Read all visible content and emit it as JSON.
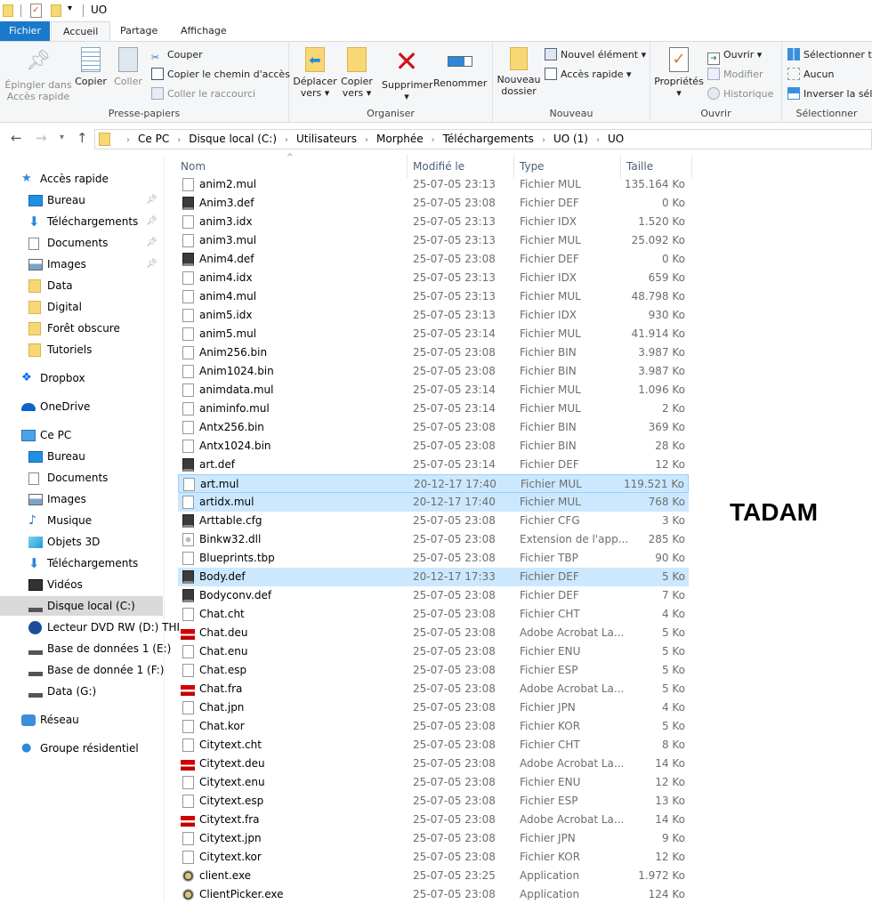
{
  "window": {
    "title": "UO"
  },
  "tabs": [
    {
      "label": "Fichier"
    },
    {
      "label": "Accueil"
    },
    {
      "label": "Partage"
    },
    {
      "label": "Affichage"
    }
  ],
  "ribbon": {
    "presse_papiers": {
      "label": "Presse-papiers",
      "pin": "Épingler dans Accès rapide",
      "pin_l1": "Épingler dans",
      "pin_l2": "Accès rapide",
      "copy": "Copier",
      "paste": "Coller",
      "cut": "Couper",
      "copy_path": "Copier le chemin d'accès",
      "paste_shortcut": "Coller le raccourci"
    },
    "organiser": {
      "label": "Organiser",
      "move_l1": "Déplacer",
      "move_l2": "vers",
      "copy_l1": "Copier",
      "copy_l2": "vers",
      "delete": "Supprimer",
      "rename": "Renommer"
    },
    "nouveau": {
      "label": "Nouveau",
      "new_folder_l1": "Nouveau",
      "new_folder_l2": "dossier",
      "new_item": "Nouvel élément",
      "easy_access": "Accès rapide"
    },
    "ouvrir": {
      "label": "Ouvrir",
      "properties": "Propriétés",
      "open": "Ouvrir",
      "edit": "Modifier",
      "history": "Historique"
    },
    "selectionner": {
      "label": "Sélectionner",
      "select_all": "Sélectionner tout",
      "none": "Aucun",
      "invert": "Inverser la sélection"
    }
  },
  "address": {
    "crumbs": [
      "Ce PC",
      "Disque local (C:)",
      "Utilisateurs",
      "Morphée",
      "Téléchargements",
      "UO (1)",
      "UO"
    ]
  },
  "sidebar": {
    "items": [
      {
        "label": "Accès rapide",
        "icon": "star-icon",
        "level": 0
      },
      {
        "label": "Bureau",
        "icon": "desktop-icon",
        "level": 1,
        "pinned": true
      },
      {
        "label": "Téléchargements",
        "icon": "download-icon",
        "level": 1,
        "pinned": true
      },
      {
        "label": "Documents",
        "icon": "documents-icon",
        "level": 1,
        "pinned": true
      },
      {
        "label": "Images",
        "icon": "images-icon",
        "level": 1,
        "pinned": true
      },
      {
        "label": "Data",
        "icon": "folder-icon",
        "level": 1
      },
      {
        "label": "Digital",
        "icon": "folder-icon",
        "level": 1
      },
      {
        "label": "Forêt obscure",
        "icon": "folder-icon",
        "level": 1
      },
      {
        "label": "Tutoriels",
        "icon": "folder-icon",
        "level": 1
      },
      {
        "label": "Dropbox",
        "icon": "dropbox-icon",
        "level": 0
      },
      {
        "label": "OneDrive",
        "icon": "onedrive-icon",
        "level": 0
      },
      {
        "label": "Ce PC",
        "icon": "computer-icon",
        "level": 0
      },
      {
        "label": "Bureau",
        "icon": "desktop-icon",
        "level": 1
      },
      {
        "label": "Documents",
        "icon": "documents-icon",
        "level": 1
      },
      {
        "label": "Images",
        "icon": "images-icon",
        "level": 1
      },
      {
        "label": "Musique",
        "icon": "music-icon",
        "level": 1
      },
      {
        "label": "Objets 3D",
        "icon": "objects3d-icon",
        "level": 1
      },
      {
        "label": "Téléchargements",
        "icon": "download-icon",
        "level": 1
      },
      {
        "label": "Vidéos",
        "icon": "videos-icon",
        "level": 1
      },
      {
        "label": "Disque local (C:)",
        "icon": "drive-icon",
        "level": 1,
        "selected": true
      },
      {
        "label": "Lecteur DVD RW (D:) THI",
        "icon": "dvd-icon",
        "level": 1
      },
      {
        "label": "Base de données 1 (E:)",
        "icon": "drive-icon",
        "level": 1
      },
      {
        "label": "Base de donnée 1 (F:)",
        "icon": "drive-icon",
        "level": 1
      },
      {
        "label": "Data (G:)",
        "icon": "drive-icon",
        "level": 1
      },
      {
        "label": "Réseau",
        "icon": "network-icon",
        "level": 0
      },
      {
        "label": "Groupe résidentiel",
        "icon": "homegroup-icon",
        "level": 0
      }
    ]
  },
  "columns": {
    "name": "Nom",
    "modified": "Modifié le",
    "type": "Type",
    "size": "Taille"
  },
  "files": [
    {
      "name": "anim2.mul",
      "date": "25-07-05 23:13",
      "type": "Fichier MUL",
      "size": "135.164 Ko",
      "icon": "file"
    },
    {
      "name": "Anim3.def",
      "date": "25-07-05 23:08",
      "type": "Fichier DEF",
      "size": "0 Ko",
      "icon": "sublime"
    },
    {
      "name": "anim3.idx",
      "date": "25-07-05 23:13",
      "type": "Fichier IDX",
      "size": "1.520 Ko",
      "icon": "file"
    },
    {
      "name": "anim3.mul",
      "date": "25-07-05 23:13",
      "type": "Fichier MUL",
      "size": "25.092 Ko",
      "icon": "file"
    },
    {
      "name": "Anim4.def",
      "date": "25-07-05 23:08",
      "type": "Fichier DEF",
      "size": "0 Ko",
      "icon": "sublime"
    },
    {
      "name": "anim4.idx",
      "date": "25-07-05 23:13",
      "type": "Fichier IDX",
      "size": "659 Ko",
      "icon": "file"
    },
    {
      "name": "anim4.mul",
      "date": "25-07-05 23:13",
      "type": "Fichier MUL",
      "size": "48.798 Ko",
      "icon": "file"
    },
    {
      "name": "anim5.idx",
      "date": "25-07-05 23:13",
      "type": "Fichier IDX",
      "size": "930 Ko",
      "icon": "file"
    },
    {
      "name": "anim5.mul",
      "date": "25-07-05 23:14",
      "type": "Fichier MUL",
      "size": "41.914 Ko",
      "icon": "file"
    },
    {
      "name": "Anim256.bin",
      "date": "25-07-05 23:08",
      "type": "Fichier BIN",
      "size": "3.987 Ko",
      "icon": "file"
    },
    {
      "name": "Anim1024.bin",
      "date": "25-07-05 23:08",
      "type": "Fichier BIN",
      "size": "3.987 Ko",
      "icon": "file"
    },
    {
      "name": "animdata.mul",
      "date": "25-07-05 23:14",
      "type": "Fichier MUL",
      "size": "1.096 Ko",
      "icon": "file"
    },
    {
      "name": "animinfo.mul",
      "date": "25-07-05 23:14",
      "type": "Fichier MUL",
      "size": "2 Ko",
      "icon": "file"
    },
    {
      "name": "Antx256.bin",
      "date": "25-07-05 23:08",
      "type": "Fichier BIN",
      "size": "369 Ko",
      "icon": "file"
    },
    {
      "name": "Antx1024.bin",
      "date": "25-07-05 23:08",
      "type": "Fichier BIN",
      "size": "28 Ko",
      "icon": "file"
    },
    {
      "name": "art.def",
      "date": "25-07-05 23:14",
      "type": "Fichier DEF",
      "size": "12 Ko",
      "icon": "sublime"
    },
    {
      "name": "art.mul",
      "date": "20-12-17 17:40",
      "type": "Fichier MUL",
      "size": "119.521 Ko",
      "icon": "file",
      "selected": true,
      "focused": true
    },
    {
      "name": "artidx.mul",
      "date": "20-12-17 17:40",
      "type": "Fichier MUL",
      "size": "768 Ko",
      "icon": "file",
      "selected": true
    },
    {
      "name": "Arttable.cfg",
      "date": "25-07-05 23:08",
      "type": "Fichier CFG",
      "size": "3 Ko",
      "icon": "sublime"
    },
    {
      "name": "Binkw32.dll",
      "date": "25-07-05 23:08",
      "type": "Extension de l'app...",
      "size": "285 Ko",
      "icon": "dll"
    },
    {
      "name": "Blueprints.tbp",
      "date": "25-07-05 23:08",
      "type": "Fichier TBP",
      "size": "90 Ko",
      "icon": "file"
    },
    {
      "name": "Body.def",
      "date": "20-12-17 17:33",
      "type": "Fichier DEF",
      "size": "5 Ko",
      "icon": "sublime",
      "selected": true
    },
    {
      "name": "Bodyconv.def",
      "date": "25-07-05 23:08",
      "type": "Fichier DEF",
      "size": "7 Ko",
      "icon": "sublime"
    },
    {
      "name": "Chat.cht",
      "date": "25-07-05 23:08",
      "type": "Fichier CHT",
      "size": "4 Ko",
      "icon": "file"
    },
    {
      "name": "Chat.deu",
      "date": "25-07-05 23:08",
      "type": "Adobe Acrobat La...",
      "size": "5 Ko",
      "icon": "acrobat"
    },
    {
      "name": "Chat.enu",
      "date": "25-07-05 23:08",
      "type": "Fichier ENU",
      "size": "5 Ko",
      "icon": "file"
    },
    {
      "name": "Chat.esp",
      "date": "25-07-05 23:08",
      "type": "Fichier ESP",
      "size": "5 Ko",
      "icon": "file"
    },
    {
      "name": "Chat.fra",
      "date": "25-07-05 23:08",
      "type": "Adobe Acrobat La...",
      "size": "5 Ko",
      "icon": "acrobat"
    },
    {
      "name": "Chat.jpn",
      "date": "25-07-05 23:08",
      "type": "Fichier JPN",
      "size": "4 Ko",
      "icon": "file"
    },
    {
      "name": "Chat.kor",
      "date": "25-07-05 23:08",
      "type": "Fichier KOR",
      "size": "5 Ko",
      "icon": "file"
    },
    {
      "name": "Citytext.cht",
      "date": "25-07-05 23:08",
      "type": "Fichier CHT",
      "size": "8 Ko",
      "icon": "file"
    },
    {
      "name": "Citytext.deu",
      "date": "25-07-05 23:08",
      "type": "Adobe Acrobat La...",
      "size": "14 Ko",
      "icon": "acrobat"
    },
    {
      "name": "Citytext.enu",
      "date": "25-07-05 23:08",
      "type": "Fichier ENU",
      "size": "12 Ko",
      "icon": "file"
    },
    {
      "name": "Citytext.esp",
      "date": "25-07-05 23:08",
      "type": "Fichier ESP",
      "size": "13 Ko",
      "icon": "file"
    },
    {
      "name": "Citytext.fra",
      "date": "25-07-05 23:08",
      "type": "Adobe Acrobat La...",
      "size": "14 Ko",
      "icon": "acrobat"
    },
    {
      "name": "Citytext.jpn",
      "date": "25-07-05 23:08",
      "type": "Fichier JPN",
      "size": "9 Ko",
      "icon": "file"
    },
    {
      "name": "Citytext.kor",
      "date": "25-07-05 23:08",
      "type": "Fichier KOR",
      "size": "12 Ko",
      "icon": "file"
    },
    {
      "name": "client.exe",
      "date": "25-07-05 23:25",
      "type": "Application",
      "size": "1.972 Ko",
      "icon": "exe"
    },
    {
      "name": "ClientPicker.exe",
      "date": "25-07-05 23:08",
      "type": "Application",
      "size": "124 Ko",
      "icon": "exe"
    }
  ],
  "annotation": {
    "text": "TADAM"
  },
  "colors": {
    "accent": "#1979ca",
    "selection": "#cce8ff",
    "selection_border": "#99d1ff",
    "folder": "#f8d775"
  }
}
